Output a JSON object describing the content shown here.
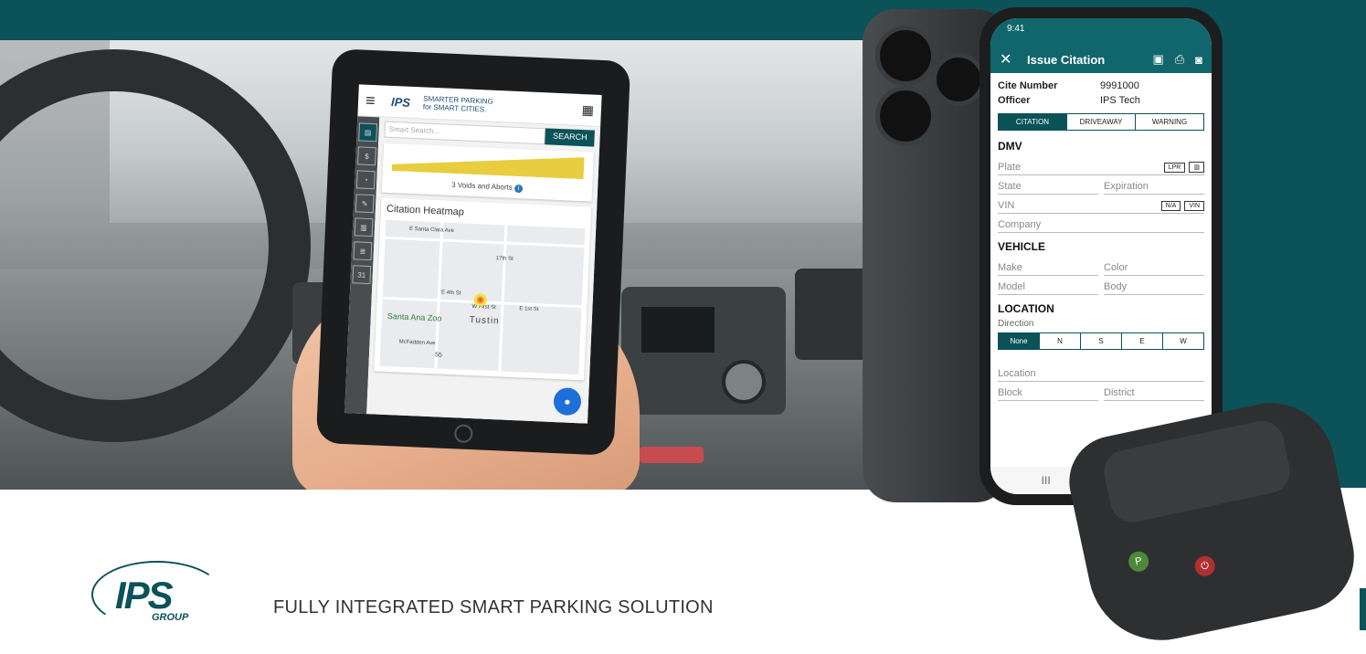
{
  "colors": {
    "brand_teal": "#0b5259",
    "app_teal": "#10666b",
    "bar_yellow": "#e8cd3e"
  },
  "tablet": {
    "tagline_1": "SMARTER PARKING",
    "tagline_2": "for SMART CITIES.",
    "sidebar_label": "Reports",
    "search_placeholder": "Smart Search...",
    "search_button": "SEARCH",
    "voids_label": "3 Voids and Aborts",
    "heatmap_title": "Citation Heatmap",
    "map_labels": [
      "E Santa Clara Ave",
      "17th St",
      "E 4th St",
      "W First St",
      "E 1st St",
      "Santa Ana Zoo",
      "Tustin",
      "McFadden Ave",
      "55"
    ]
  },
  "phone": {
    "time": "9:41",
    "title": "Issue Citation",
    "cite_number_label": "Cite Number",
    "cite_number_value": "9991000",
    "officer_label": "Officer",
    "officer_value": "IPS Tech",
    "tabs": [
      "CITATION",
      "DRIVEAWAY",
      "WARNING"
    ],
    "dmv_heading": "DMV",
    "plate": "Plate",
    "lpr_tag": "LPR",
    "state": "State",
    "expiration": "Expiration",
    "vin": "VIN",
    "na_tag": "N/A",
    "vin_tag": "VIN",
    "company": "Company",
    "vehicle_heading": "VEHICLE",
    "make": "Make",
    "color": "Color",
    "model": "Model",
    "body": "Body",
    "location_heading": "LOCATION",
    "direction_label": "Direction",
    "directions": [
      "None",
      "N",
      "S",
      "E",
      "W"
    ],
    "location_field": "Location",
    "block": "Block",
    "district": "District",
    "nav": [
      "III",
      "O"
    ]
  },
  "footer": {
    "logo_text": "IPS",
    "logo_sub": "GROUP",
    "tagline": "FULLY INTEGRATED SMART PARKING SOLUTION"
  }
}
